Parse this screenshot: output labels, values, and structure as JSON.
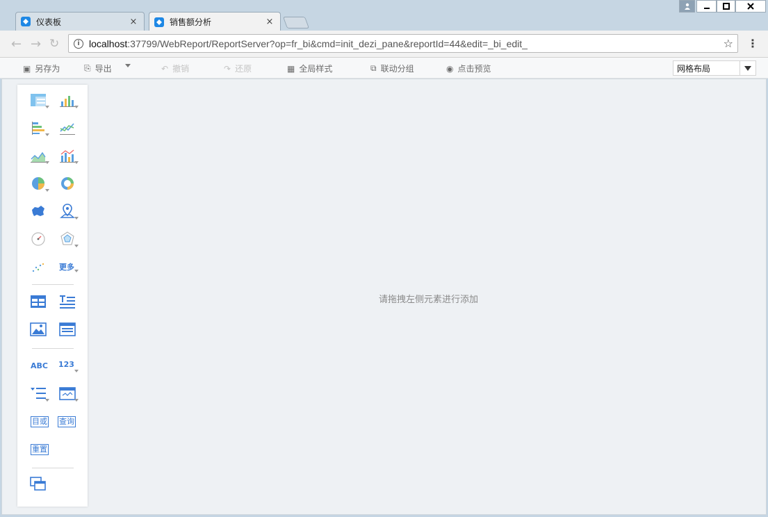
{
  "browser": {
    "tabs": [
      {
        "label": "仪表板",
        "active": false
      },
      {
        "label": "销售额分析",
        "active": true
      }
    ],
    "close_glyph": "×",
    "url_host": "localhost",
    "url_rest": ":37799/WebReport/ReportServer?op=fr_bi&cmd=init_dezi_pane&reportId=44&edit=_bi_edit_",
    "window_controls": {
      "user": "user-icon",
      "minimize": "minimize-icon",
      "maximize": "maximize-icon",
      "close": "close-icon"
    }
  },
  "toolbar": {
    "save_as": "另存为",
    "export": "导出",
    "undo": "撤销",
    "redo": "还原",
    "global_style": "全局样式",
    "linkage_group": "联动分组",
    "preview": "点击预览",
    "layout_select": "网格布局"
  },
  "palette": {
    "more_label": "更多",
    "abc_label": "ABC",
    "num_label": "123",
    "tree_label": "目或",
    "query_label": "查询",
    "reset_label": "重置"
  },
  "canvas": {
    "hint": "请拖拽左侧元素进行添加"
  },
  "colors": {
    "accent": "#3a7bd5",
    "chrome_bg": "#c6d6e3",
    "workspace_bg": "#eef1f4"
  }
}
